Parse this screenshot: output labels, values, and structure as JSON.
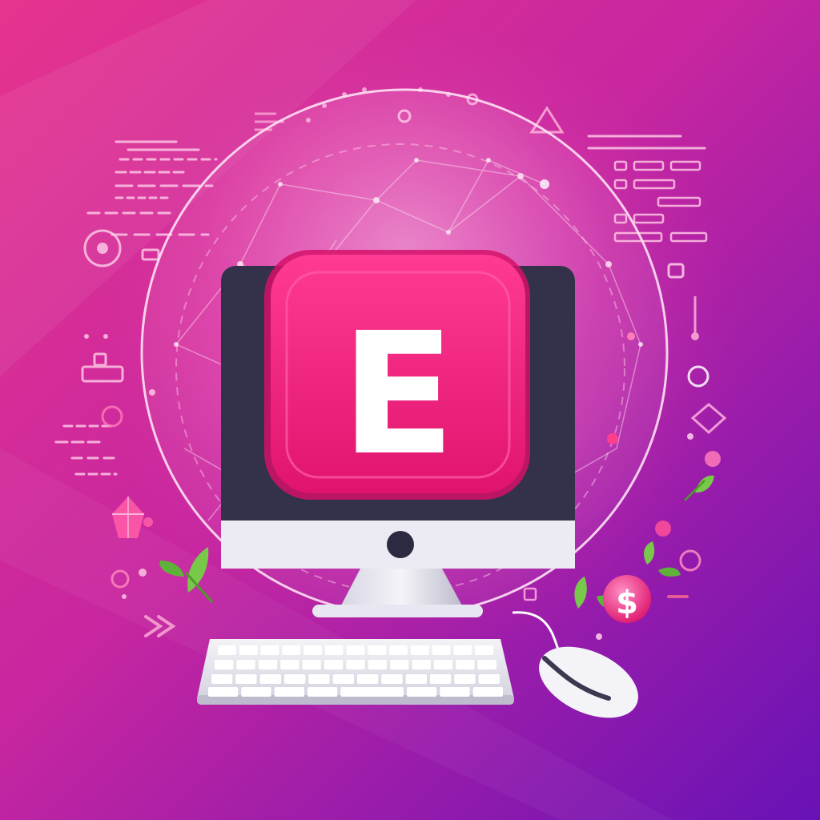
{
  "logo": {
    "letter": "E"
  },
  "dollar_sign": "$",
  "colors": {
    "background_top": "#e0388f",
    "background_bottom": "#6c16b8",
    "app_icon_pink": "#f0207a",
    "app_icon_pink_dark": "#d81466",
    "monitor_screen": "#33324a",
    "monitor_chin": "#e9e8f0",
    "keyboard": "#e6e6ee",
    "mouse": "#f2f2f6",
    "leaf_green": "#74c444",
    "accent_pink": "#ff5aa8"
  },
  "icons": [
    "network-globe-icon",
    "app-logo-icon",
    "monitor-icon",
    "keyboard-icon",
    "mouse-icon",
    "leaf-icon",
    "dollar-orb-icon",
    "warning-triangle-icon",
    "gem-icon"
  ]
}
